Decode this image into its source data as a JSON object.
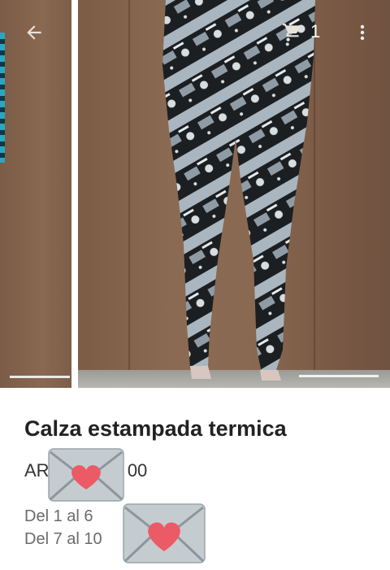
{
  "header": {
    "cart_count": "1"
  },
  "product": {
    "title": "Calza estampada termica",
    "price_prefix": "AR",
    "price_suffix": "00",
    "installments_1": "Del 1 al 6",
    "installments_2": "Del 7 al 10"
  },
  "icons": [
    "back-arrow-icon",
    "cart-icon",
    "more-vert-icon",
    "heart-envelope-icon"
  ],
  "colors": {
    "title": "#222222",
    "secondary_text": "#6b6b6b",
    "wall": "#7d5c46"
  }
}
